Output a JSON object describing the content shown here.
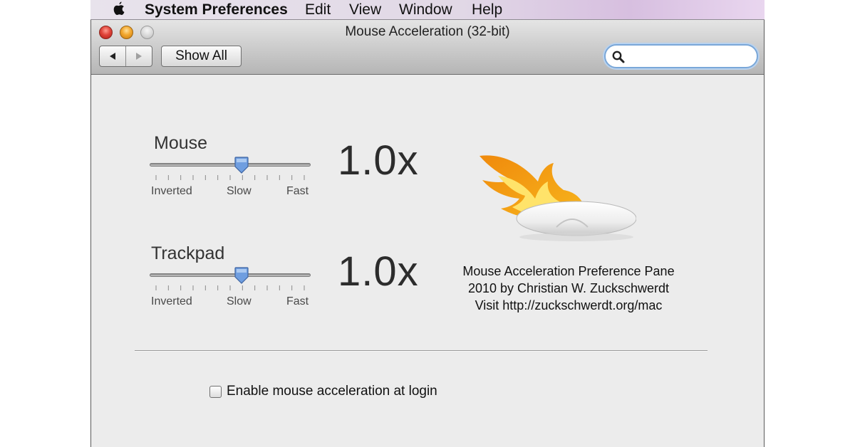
{
  "menubar": {
    "apple_icon": "apple-logo-icon",
    "items": [
      "System Preferences",
      "Edit",
      "View",
      "Window",
      "Help"
    ]
  },
  "window": {
    "title": "Mouse Acceleration (32-bit)",
    "controls": [
      "close",
      "minimize",
      "zoom"
    ],
    "toolbar": {
      "back_icon": "triangle-left-icon",
      "forward_icon": "triangle-right-icon",
      "show_all_label": "Show All",
      "search": {
        "placeholder": "",
        "value": "",
        "icon": "magnifier-icon"
      }
    }
  },
  "sliders": [
    {
      "title": "Mouse",
      "value_label": "1.0x",
      "level": 0.57,
      "ticks": 13,
      "labels": [
        "Inverted",
        "Slow",
        "Fast"
      ]
    },
    {
      "title": "Trackpad",
      "value_label": "1.0x",
      "level": 0.57,
      "ticks": 13,
      "labels": [
        "Inverted",
        "Slow",
        "Fast"
      ]
    }
  ],
  "illustration": {
    "icon": "flaming-mouse-icon"
  },
  "credits": [
    "Mouse Acceleration Preference Pane",
    "2010 by Christian W. Zuckschwerdt",
    "Visit http://zuckschwerdt.org/mac"
  ],
  "login_option": {
    "label": "Enable mouse acceleration at login",
    "checked": false
  },
  "colors": {
    "accent": "#7aa7d8",
    "knob": "#6f9ee0",
    "flame_outer": "#f2a516",
    "flame_inner": "#ffe36a"
  }
}
